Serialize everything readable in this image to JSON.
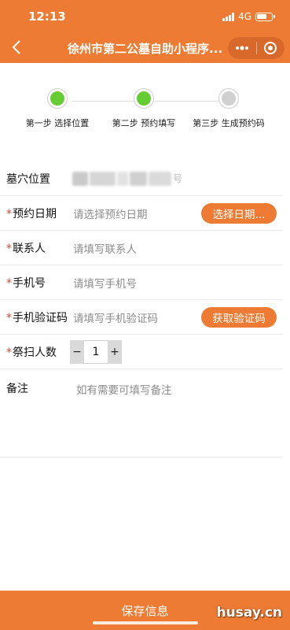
{
  "status_bar": {
    "time": "12:13",
    "network": "4G"
  },
  "nav": {
    "title": "徐州市第二公墓自助小程序...",
    "back_icon": "chevron-left-icon"
  },
  "colors": {
    "accent": "#ee7b33",
    "done": "#66cc33",
    "pending": "#d0d0d0",
    "required": "#e0402a"
  },
  "steps": [
    {
      "label": "第一步 选择位置",
      "state": "done"
    },
    {
      "label": "第二步 预约填写",
      "state": "done"
    },
    {
      "label": "第三步 生成预约码",
      "state": "pending"
    }
  ],
  "form": {
    "grave": {
      "label": "墓穴位置",
      "value_tail": "号"
    },
    "date": {
      "required_mark": "*",
      "label": "预约日期",
      "placeholder": "请选择预约日期",
      "button": "选择日期..."
    },
    "contact": {
      "required_mark": "*",
      "label": "联系人",
      "placeholder": "请填写联系人"
    },
    "phone": {
      "required_mark": "*",
      "label": "手机号",
      "placeholder": "请填写手机号"
    },
    "code": {
      "required_mark": "*",
      "label": "手机验证码",
      "placeholder": "请填写手机验证码",
      "button": "获取验证码"
    },
    "people": {
      "required_mark": "*",
      "label": "祭扫人数",
      "minus": "−",
      "value": "1",
      "plus": "+"
    },
    "remark": {
      "label": "备注",
      "placeholder": "如有需要可填写备注"
    }
  },
  "footer": {
    "save_label": "保存信息",
    "watermark": "husay.cn"
  }
}
